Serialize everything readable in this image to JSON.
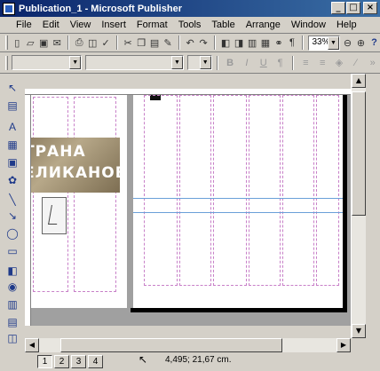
{
  "window": {
    "title": "Publication_1 - Microsoft Publisher",
    "minimize_glyph": "_",
    "maximize_glyph": "□",
    "close_glyph": "×"
  },
  "menu": [
    "File",
    "Edit",
    "View",
    "Insert",
    "Format",
    "Tools",
    "Table",
    "Arrange",
    "Window",
    "Help"
  ],
  "toolbar": {
    "zoom_value": "33%",
    "zoom_out_glyph": "⊖",
    "zoom_in_glyph": "⊕",
    "help_glyph": "?"
  },
  "format_toolbar": {
    "bold": "B",
    "italic": "I",
    "underline": "U",
    "paragraph_glyph": "¶"
  },
  "banner": {
    "line1": "ТРАНА",
    "line2": "ЕЛИКАНОВ"
  },
  "status": {
    "pages": [
      "1",
      "2",
      "3",
      "4"
    ],
    "active_page": "1",
    "coordinates": "4,495; 21,67 cm."
  },
  "colors": {
    "title_start": "#0a246a",
    "title_end": "#3a6ea5",
    "chrome": "#d4d0c8",
    "workspace": "#a0a0a0",
    "guides": "#c880c8"
  }
}
